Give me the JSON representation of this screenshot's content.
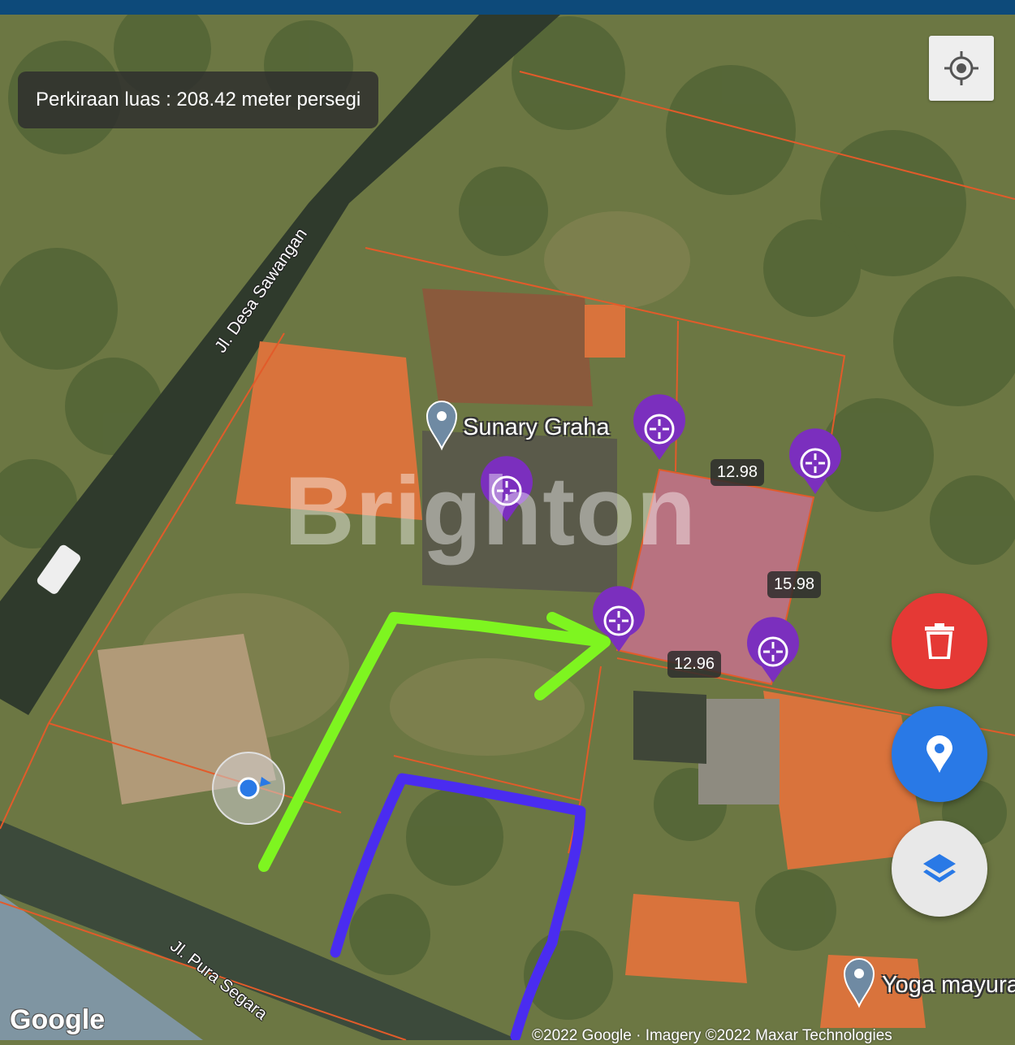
{
  "top_bar": {
    "color": "#0d4a7a"
  },
  "area_estimate": {
    "text": "Perkiraan luas : 208.42 meter persegi"
  },
  "controls": {
    "gps": {
      "icon": "crosshair-gps-icon"
    },
    "delete": {
      "icon": "trash-icon",
      "color": "#e53935"
    },
    "location": {
      "icon": "map-pin-icon",
      "color": "#2979e6"
    },
    "layers": {
      "icon": "layers-icon",
      "color": "#e8e8e8"
    }
  },
  "measurements": {
    "top": "12.98",
    "right": "15.98",
    "bottom": "12.96"
  },
  "places": {
    "sunary": "Sunary Graha",
    "yoga": "Yoga mayura"
  },
  "roads": {
    "desa": "Jl. Desa Sawangan",
    "pura": "Jl. Pura Segara"
  },
  "watermark": "Brighton",
  "attribution": {
    "logo": "Google",
    "copyright": "©2022 Google · Imagery ©2022 Maxar Technologies"
  },
  "colors": {
    "parcel_fill": "#d9709a",
    "marker": "#7b2fbe",
    "parcel_lines": "#e25b2a",
    "green_arrow": "#7ef520",
    "blue_outline": "#4a2cf0"
  }
}
